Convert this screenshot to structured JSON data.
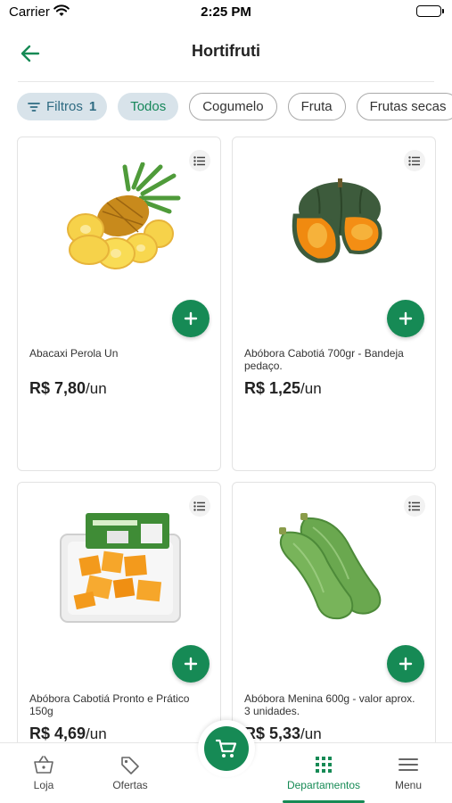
{
  "status_bar": {
    "carrier": "Carrier",
    "time": "2:25 PM"
  },
  "header": {
    "title": "Hortifruti"
  },
  "chips": {
    "filter_label": "Filtros",
    "filter_count": "1",
    "items": [
      "Todos",
      "Cogumelo",
      "Fruta",
      "Frutas secas"
    ]
  },
  "products": [
    {
      "name": "Abacaxi Perola Un",
      "price": "R$ 7,80",
      "unit": "/un",
      "image": "pineapple"
    },
    {
      "name": "Abóbora Cabotiá 700gr - Bandeja pedaço.",
      "price": "R$ 1,25",
      "unit": "/un",
      "image": "pumpkin"
    },
    {
      "name": "Abóbora Cabotiá Pronto e Prático 150g",
      "price": "R$ 4,69",
      "unit": "/un",
      "image": "pumpkin-tray"
    },
    {
      "name": "Abóbora Menina 600g - valor aprox. 3 unidades.",
      "price": "R$ 5,33",
      "unit": "/un",
      "image": "squash"
    }
  ],
  "bottom_nav": {
    "items": [
      {
        "label": "Loja",
        "icon": "store-basket-icon"
      },
      {
        "label": "Ofertas",
        "icon": "tag-icon"
      },
      {
        "label": "Departamentos",
        "icon": "grid-icon"
      },
      {
        "label": "Menu",
        "icon": "menu-icon"
      }
    ],
    "active": "Departamentos",
    "cart_icon": "cart-icon"
  },
  "colors": {
    "primary": "#168a55",
    "chip_bg": "#d8e3ea",
    "chip_filter_text": "#2e6b82"
  }
}
